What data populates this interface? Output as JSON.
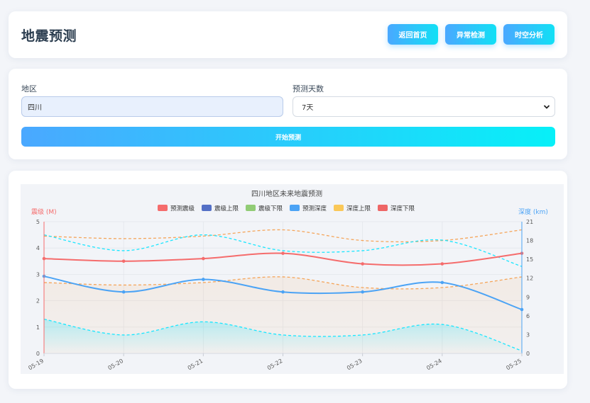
{
  "header": {
    "title": "地震预测",
    "buttons": [
      "返回首页",
      "异常检测",
      "时空分析"
    ]
  },
  "form": {
    "region_label": "地区",
    "region_value": "四川",
    "days_label": "预测天数",
    "days_value": "7天",
    "submit_label": "开始预测"
  },
  "colors": {
    "magnitude": "#f56c6c",
    "mag_upper": "#5470c6",
    "mag_lower": "#91cc75",
    "depth": "#4ba3f5",
    "depth_upper": "#fac858",
    "depth_lower": "#ee6666",
    "band_mag": "#19e6ff",
    "band_depth": "#f5a55a",
    "accent_from": "#4aa8ff",
    "accent_to": "#11e0f5"
  },
  "chart_data": {
    "type": "line",
    "title": "四川地区未来地震预测",
    "x": [
      "05-19",
      "05-20",
      "05-21",
      "05-22",
      "05-23",
      "05-24",
      "05-25"
    ],
    "y_left": {
      "label": "震级 (M)",
      "range": [
        0,
        5
      ],
      "ticks": [
        "0",
        "1",
        "2",
        "3",
        "4",
        "5"
      ]
    },
    "y_right": {
      "label": "深度 (km)",
      "range": [
        0,
        21
      ],
      "ticks": [
        "0",
        "3",
        "6",
        "9",
        "12",
        "15",
        "18",
        "21"
      ]
    },
    "legend": [
      "预测震级",
      "震级上限",
      "震级下限",
      "预测深度",
      "深度上限",
      "深度下限"
    ],
    "legend_position": "top-center",
    "grid": true,
    "series": [
      {
        "name": "预测震级",
        "axis": "left",
        "values": [
          3.6,
          3.5,
          3.6,
          3.8,
          3.4,
          3.4,
          3.8
        ]
      },
      {
        "name": "震级上限",
        "axis": "left",
        "values": [
          4.5,
          3.9,
          4.5,
          3.9,
          3.9,
          4.3,
          3.3
        ]
      },
      {
        "name": "震级下限",
        "axis": "left",
        "values": [
          1.3,
          0.7,
          1.2,
          0.7,
          0.7,
          1.1,
          0.1
        ]
      },
      {
        "name": "预测深度",
        "axis": "right",
        "values": [
          12.3,
          9.8,
          11.8,
          9.8,
          9.8,
          11.3,
          7.0
        ]
      },
      {
        "name": "深度上限",
        "axis": "right",
        "values": [
          18.7,
          18.3,
          18.7,
          19.7,
          18.0,
          18.0,
          19.7
        ]
      },
      {
        "name": "深度下限",
        "axis": "right",
        "values": [
          11.3,
          10.9,
          11.3,
          12.2,
          10.5,
          10.5,
          12.2
        ]
      }
    ]
  }
}
